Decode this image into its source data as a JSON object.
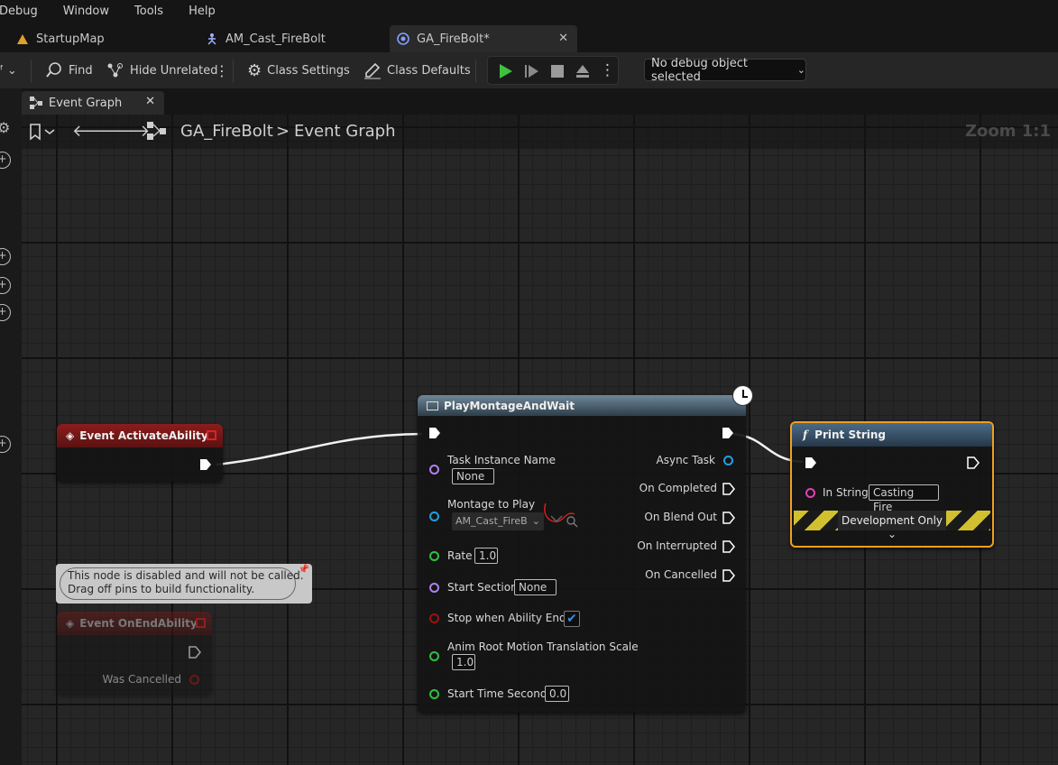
{
  "menu": [
    "Debug",
    "Window",
    "Tools",
    "Help"
  ],
  "tabs": [
    {
      "label": "StartupMap",
      "icon": "level-icon"
    },
    {
      "label": "AM_Cast_FireBolt",
      "icon": "anim-montage-icon"
    },
    {
      "label": "GA_FireBolt*",
      "icon": "blueprint-icon",
      "active": true
    }
  ],
  "toolbar": {
    "find": "Find",
    "hide_unrelated": "Hide Unrelated",
    "class_settings": "Class Settings",
    "class_defaults": "Class Defaults",
    "debug_object": "No debug object selected"
  },
  "graph_tab": {
    "label": "Event Graph"
  },
  "breadcrumb": {
    "root": "GA_FireBolt",
    "sep": ">",
    "leaf": "Event Graph"
  },
  "zoom": "Zoom 1:1",
  "nodes": {
    "activate": {
      "title": "Event ActivateAbility"
    },
    "endability": {
      "title": "Event OnEndAbility",
      "pin": "Was Cancelled"
    },
    "disabled_comment": {
      "line1": "This node is disabled and will not be called.",
      "line2": "Drag off pins to build functionality."
    },
    "montage": {
      "title": "PlayMontageAndWait",
      "inputs": {
        "task_instance_name": "Task Instance Name",
        "task_instance_value": "None",
        "montage_to_play": "Montage to Play",
        "montage_value": "AM_Cast_FireB",
        "rate": "Rate",
        "rate_value": "1.0",
        "start_section": "Start Section",
        "start_section_value": "None",
        "stop_when_ends": "Stop when Ability Ends",
        "root_motion": "Anim Root Motion Translation Scale",
        "root_motion_value": "1.0",
        "start_time": "Start Time Seconds",
        "start_time_value": "0.0"
      },
      "outputs": {
        "async_task": "Async Task",
        "on_completed": "On Completed",
        "on_blend_out": "On Blend Out",
        "on_interrupted": "On Interrupted",
        "on_cancelled": "On Cancelled"
      }
    },
    "print": {
      "title": "Print String",
      "in_string": "In String",
      "in_string_value": "Casting Fire",
      "dev_only": "Development Only"
    }
  },
  "colors": {
    "event_header": "#8c1c1c",
    "function_header": "#3a5a78",
    "selected_outline": "#f0a020",
    "pin_string": "#e040b0",
    "pin_object": "#20a0e0",
    "pin_float": "#30c040",
    "pin_name": "#b080f0",
    "pin_bool": "#a01010",
    "play_green": "#3ec23e"
  }
}
